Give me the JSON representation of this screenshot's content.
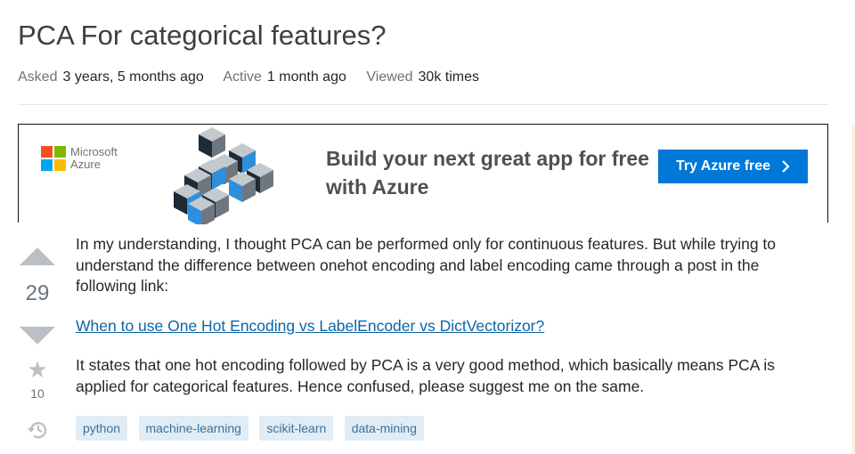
{
  "question": {
    "title": "PCA For categorical features?",
    "meta": {
      "asked_label": "Asked",
      "asked_value": "3 years, 5 months ago",
      "active_label": "Active",
      "active_value": "1 month ago",
      "viewed_label": "Viewed",
      "viewed_value": "30k times"
    },
    "score": "29",
    "favorites": "10",
    "paragraph1": "In my understanding, I thought PCA can be performed only for continuous features. But while trying to understand the difference between onehot encoding and label encoding came through a post in the following link:",
    "link_text": "When to use One Hot Encoding vs LabelEncoder vs DictVectorizor?",
    "paragraph2": "It states that one hot encoding followed by PCA is a very good method, which basically means PCA is applied for categorical features. Hence confused, please suggest me on the same.",
    "tags": [
      "python",
      "machine-learning",
      "scikit-learn",
      "data-mining"
    ]
  },
  "ad": {
    "brand_line1": "Microsoft",
    "brand_line2": "Azure",
    "headline": "Build your next great app for free with Azure",
    "cta_label": "Try Azure free",
    "cta_icon": "chevron-right-icon",
    "colors": {
      "cta_bg": "#0078d7",
      "logo_red": "#f25022",
      "logo_green": "#7fba00",
      "logo_blue": "#00a4ef",
      "logo_yellow": "#ffb900"
    }
  },
  "icons": {
    "upvote": "upvote-arrow-icon",
    "downvote": "downvote-arrow-icon",
    "favorite": "star-icon",
    "history": "history-icon"
  }
}
